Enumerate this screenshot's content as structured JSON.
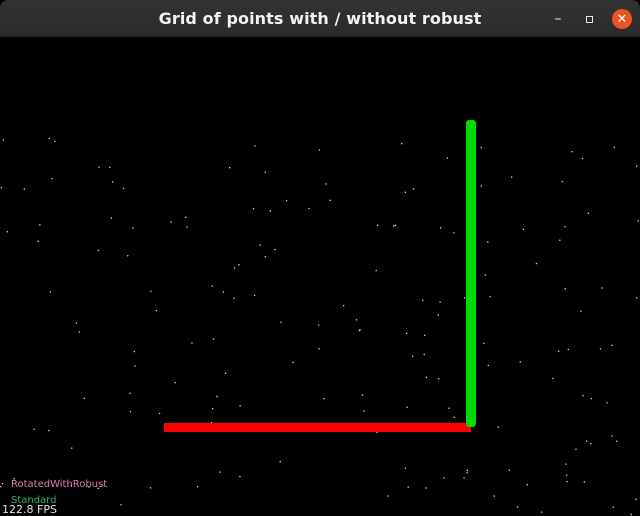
{
  "window": {
    "title": "Grid of points with / without robust",
    "buttons": {
      "minimize": "–",
      "close": "✕"
    }
  },
  "scene": {
    "legend": [
      {
        "label": "RotatedWithRobust",
        "color": "#e17bb0"
      },
      {
        "label": "Standard",
        "color": "#2fb56a"
      }
    ],
    "fps": "122.8 FPS",
    "axes": [
      {
        "name": "x-axis",
        "color": "#ff0000"
      },
      {
        "name": "y-axis",
        "color": "#00dd00"
      }
    ],
    "background": "#000000",
    "point_color": "#d8d8d8"
  }
}
